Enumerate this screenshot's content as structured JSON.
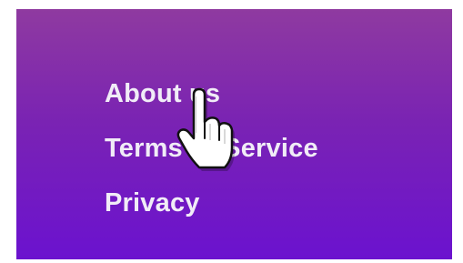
{
  "menu": {
    "items": [
      {
        "label": "About us"
      },
      {
        "label": "Terms of Service"
      },
      {
        "label": "Privacy"
      }
    ]
  },
  "colors": {
    "background_top": "#8f3aa0",
    "background_bottom": "#6b12cf",
    "link_text": "#f1ecf7"
  },
  "cursor": {
    "icon": "hand-pointer-icon"
  }
}
